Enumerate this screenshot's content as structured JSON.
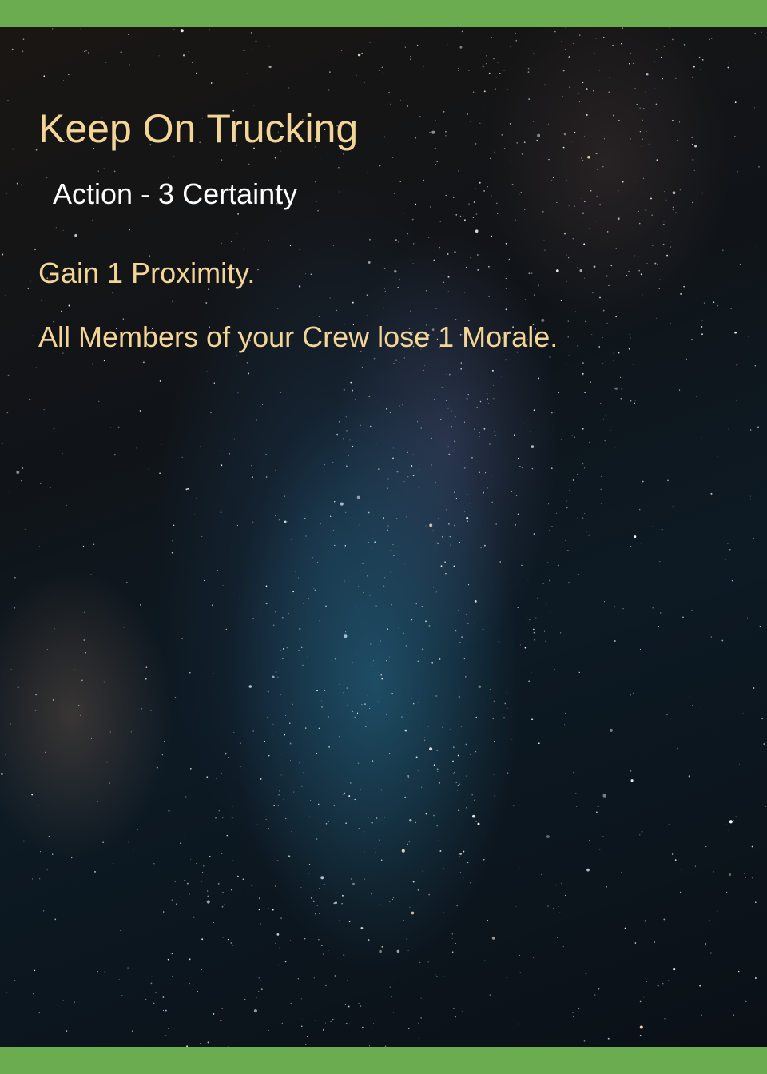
{
  "card": {
    "title": "Keep On Trucking",
    "subtitle": "Action - 3 Certainty",
    "rules": [
      "Gain 1 Proximity.",
      "All Members of your Crew lose 1 Morale."
    ]
  },
  "colors": {
    "band": "#6aac4f",
    "title_text": "#f3d597",
    "subtitle_text": "#ffffff",
    "rules_text": "#f3d597"
  }
}
